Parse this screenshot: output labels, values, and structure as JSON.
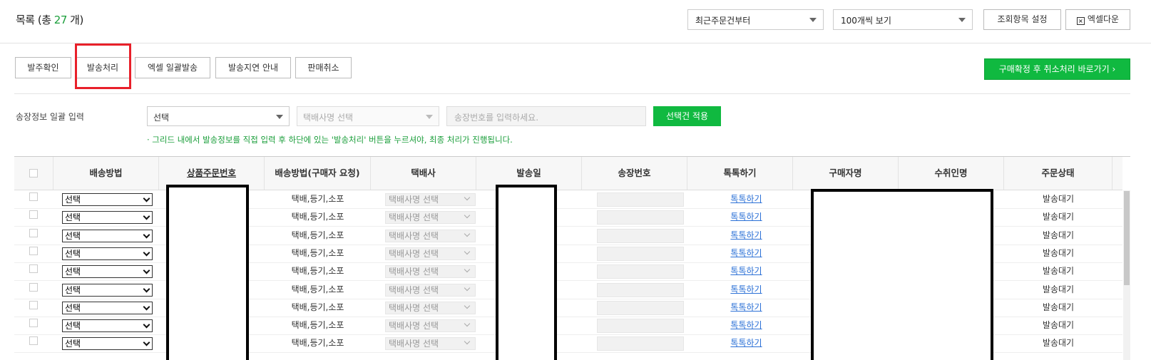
{
  "header": {
    "title_prefix": "목록 (총 ",
    "title_count": "27",
    "title_suffix": " 개)",
    "sort_select": "최근주문건부터",
    "page_size_select": "100개씩 보기",
    "column_setting_button": "조회항목 설정",
    "excel_download_button": "엑셀다운"
  },
  "actions": {
    "confirm_order": "발주확인",
    "ship": "발송처리",
    "excel_bulk_ship": "엑셀 일괄발송",
    "delay_notice": "발송지연 안내",
    "cancel_sale": "판매취소",
    "go_cancel": "구매확정 후 취소처리 바로가기 ›"
  },
  "bulk": {
    "label": "송장정보 일괄 입력",
    "method_select": "선택",
    "courier_select": "택배사명 선택",
    "invoice_placeholder": "송장번호를 입력하세요.",
    "apply_button": "선택건 적용",
    "notice": "· 그리드 내에서 발송정보를 직접 입력 후 하단에 있는 '발송처리' 버튼을 누르셔야, 최종 처리가 진행됩니다."
  },
  "table": {
    "columns": [
      "배송방법",
      "상품주문번호",
      "배송방법(구매자 요청)",
      "택배사",
      "발송일",
      "송장번호",
      "톡톡하기",
      "구매자명",
      "수취인명",
      "주문상태"
    ],
    "rows": [
      {
        "method": "선택",
        "requested": "택배,등기,소포",
        "courier": "택배사명 선택",
        "talk": "톡톡하기",
        "status": "발송대기"
      },
      {
        "method": "선택",
        "requested": "택배,등기,소포",
        "courier": "택배사명 선택",
        "talk": "톡톡하기",
        "status": "발송대기"
      },
      {
        "method": "선택",
        "requested": "택배,등기,소포",
        "courier": "택배사명 선택",
        "talk": "톡톡하기",
        "status": "발송대기"
      },
      {
        "method": "선택",
        "requested": "택배,등기,소포",
        "courier": "택배사명 선택",
        "talk": "톡톡하기",
        "status": "발송대기"
      },
      {
        "method": "선택",
        "requested": "택배,등기,소포",
        "courier": "택배사명 선택",
        "talk": "톡톡하기",
        "status": "발송대기"
      },
      {
        "method": "선택",
        "requested": "택배,등기,소포",
        "courier": "택배사명 선택",
        "talk": "톡톡하기",
        "status": "발송대기"
      },
      {
        "method": "선택",
        "requested": "택배,등기,소포",
        "courier": "택배사명 선택",
        "talk": "톡톡하기",
        "status": "발송대기"
      },
      {
        "method": "선택",
        "requested": "택배,등기,소포",
        "courier": "택배사명 선택",
        "talk": "톡톡하기",
        "status": "발송대기"
      },
      {
        "method": "선택",
        "requested": "택배,등기,소포",
        "courier": "택배사명 선택",
        "talk": "톡톡하기",
        "status": "발송대기"
      }
    ]
  },
  "colors": {
    "accent_green": "#10b940",
    "count_green": "#1a9e3a",
    "highlight_red": "#e8202a",
    "link_blue": "#2a6fd6"
  }
}
